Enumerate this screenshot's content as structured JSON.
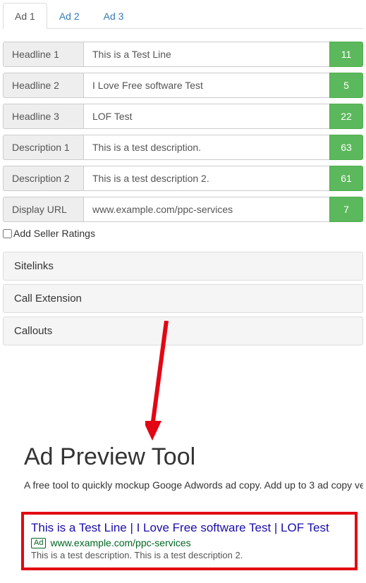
{
  "tabs": [
    {
      "label": "Ad 1"
    },
    {
      "label": "Ad 2"
    },
    {
      "label": "Ad 3"
    }
  ],
  "fields": {
    "headline1": {
      "label": "Headline 1",
      "value": "This is a Test Line",
      "count": "11"
    },
    "headline2": {
      "label": "Headline 2",
      "value": "I Love Free software Test",
      "count": "5"
    },
    "headline3": {
      "label": "Headline 3",
      "value": "LOF Test",
      "count": "22"
    },
    "desc1": {
      "label": "Description 1",
      "value": "This is a test description.",
      "count": "63"
    },
    "desc2": {
      "label": "Description 2",
      "value": "This is a test description 2.",
      "count": "61"
    },
    "url": {
      "label": "Display URL",
      "value": "www.example.com/ppc-services",
      "count": "7"
    }
  },
  "seller_ratings_label": "Add Seller Ratings",
  "panels": {
    "sitelinks": "Sitelinks",
    "call_extension": "Call Extension",
    "callouts": "Callouts"
  },
  "preview": {
    "title": "Ad Preview Tool",
    "subtitle": "A free tool to quickly mockup Googe Adwords ad copy. Add up to 3 ad copy ve",
    "ad_badge": "Ad",
    "ad_headline": "This is a Test Line | I Love Free software Test | LOF Test",
    "ad_url": "www.example.com/ppc-services",
    "ad_desc": "This is a test description. This is a test description 2."
  },
  "colors": {
    "accent_green": "#5cb85c",
    "annotation_red": "#e30613",
    "link_blue": "#1a0dab",
    "url_green": "#006621"
  }
}
